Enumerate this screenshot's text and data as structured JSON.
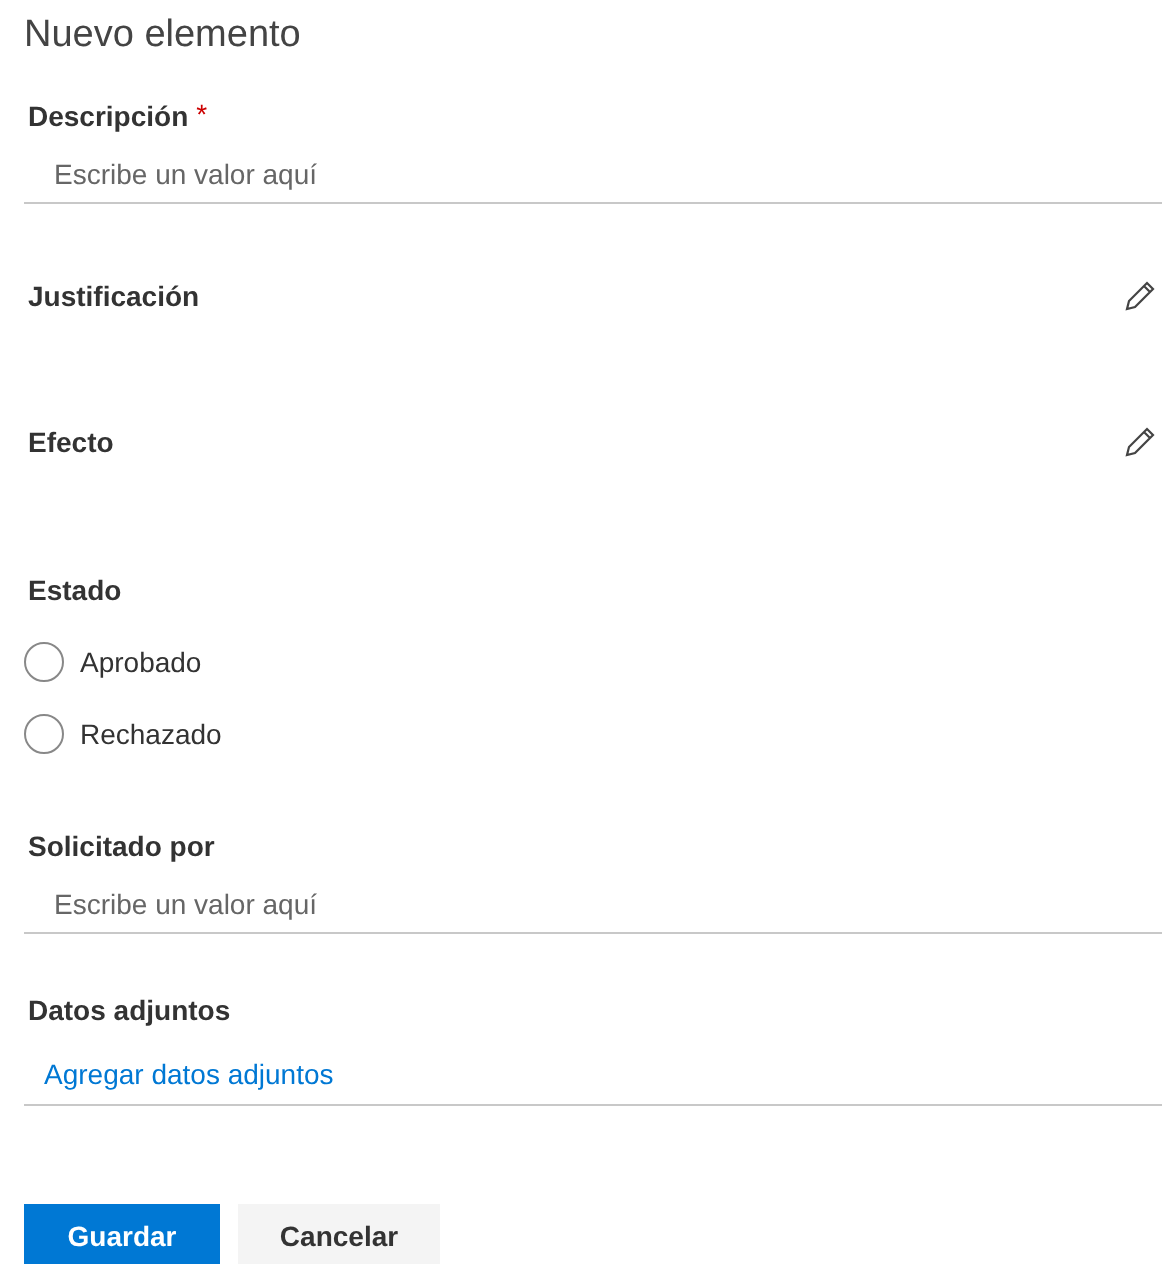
{
  "title": "Nuevo elemento",
  "fields": [
    {
      "kind": "text",
      "label": "Descripción",
      "required_mark": "*",
      "placeholder": "Escribe un valor aquí"
    },
    {
      "kind": "richtext",
      "label": "Justificación"
    },
    {
      "kind": "richtext",
      "label": "Efecto"
    },
    {
      "kind": "radio",
      "label": "Estado",
      "options": [
        {
          "label": "Aprobado",
          "selected": false
        },
        {
          "label": "Rechazado",
          "selected": false
        }
      ]
    },
    {
      "kind": "text",
      "label": "Solicitado por",
      "placeholder": "Escribe un valor aquí"
    },
    {
      "kind": "attachment",
      "label": "Datos adjuntos",
      "link": "Agregar datos adjuntos"
    }
  ],
  "buttons": [
    {
      "label": "Guardar",
      "primary": true
    },
    {
      "label": "Cancelar",
      "primary": false
    }
  ]
}
